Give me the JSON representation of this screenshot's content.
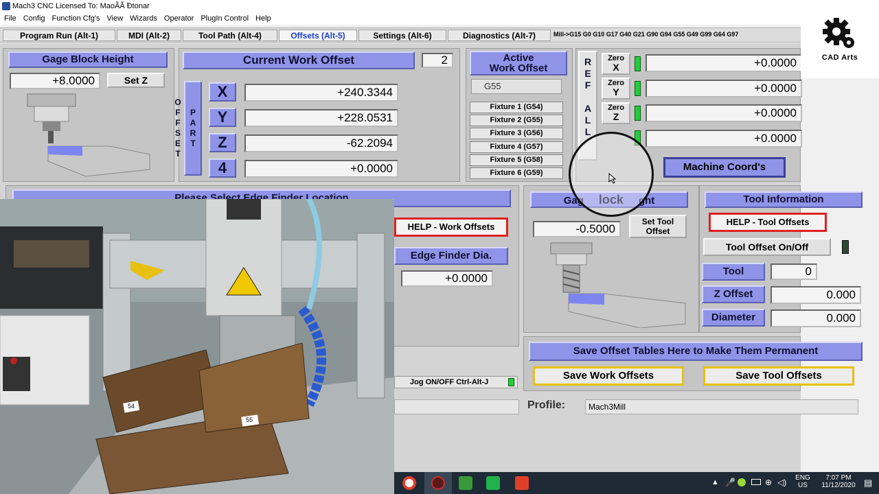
{
  "window": {
    "title": "Mach3 CNC  Licensed To: MaoÃÃ ̃Ðtonar"
  },
  "menu": [
    "File",
    "Config",
    "Function Cfg's",
    "View",
    "Wizards",
    "Operator",
    "PlugIn Control",
    "Help"
  ],
  "tabs": [
    {
      "label": "Program Run (Alt-1)"
    },
    {
      "label": "MDI (Alt-2)"
    },
    {
      "label": "Tool Path (Alt-4)"
    },
    {
      "label": "Offsets (Alt-5)"
    },
    {
      "label": "Settings (Alt-6)"
    },
    {
      "label": "Diagnostics (Alt-7)"
    }
  ],
  "gcodes": "Mill->G15  G0 G10 G17 G40 G21 G90 G94 G55 G49 G99 G64 G97",
  "gage_block_top": {
    "title": "Gage Block Height",
    "value": "+8.0000",
    "set_label": "Set Z"
  },
  "work_offset": {
    "title": "Current Work Offset",
    "index": "2",
    "side_label": "PART OFFSET",
    "axes": [
      {
        "axis": "X",
        "value": "+240.3344"
      },
      {
        "axis": "Y",
        "value": "+228.0531"
      },
      {
        "axis": "Z",
        "value": "-62.2094"
      },
      {
        "axis": "4",
        "value": "+0.0000"
      }
    ]
  },
  "active_offset": {
    "title_line1": "Active",
    "title_line2": "Work Offset",
    "value": "G55",
    "fixtures": [
      "Fixture 1 (G54)",
      "Fixture 2 (G55)",
      "Fixture 3 (G56)",
      "Fixture 4 (G57)",
      "Fixture 5 (G58)",
      "Fixture 6 (G59)"
    ]
  },
  "ref_all_home": "REF ALL HO",
  "zero_buttons": [
    {
      "label": "Zero",
      "axis": "X",
      "value": "+0.0000"
    },
    {
      "label": "Zero",
      "axis": "Y",
      "value": "+0.0000"
    },
    {
      "label": "Zero",
      "axis": "Z",
      "value": "+0.0000"
    },
    {
      "label": "",
      "axis": "",
      "value": "+0.0000"
    }
  ],
  "machine_coords_label": "Machine Coord's",
  "edge_finder": {
    "title": "Please Select Edge Finder Location",
    "help_label": "HELP - Work Offsets",
    "dia_label": "Edge Finder Dia.",
    "dia_value": "+0.0000",
    "jog_label": "Jog ON/OFF Ctrl-Alt-J"
  },
  "gage_block_tool": {
    "title_left": "Gag",
    "title_mid": "lock",
    "title_right": "ght",
    "value": "-0.5000",
    "set_label_1": "Set Tool",
    "set_label_2": "Offset"
  },
  "tool_info": {
    "title": "Tool Information",
    "help_label": "HELP - Tool Offsets",
    "toggle_label": "Tool Offset On/Off",
    "tool_label": "Tool",
    "tool_value": "0",
    "zoffset_label": "Z Offset",
    "zoffset_value": "0.000",
    "diameter_label": "Diameter",
    "diameter_value": "0.000"
  },
  "save": {
    "title": "Save Offset Tables Here to Make Them Permanent",
    "work_label": "Save Work Offsets",
    "tool_label": "Save Tool Offsets"
  },
  "profile": {
    "label": "Profile:",
    "value": "Mach3Mill"
  },
  "taskbar": {
    "lang1": "ENG",
    "lang2": "US",
    "time": "7:07 PM",
    "date": "11/12/2020"
  },
  "logo": {
    "text": "CAD Arts"
  },
  "video_labels": {
    "tag1": "54",
    "tag2": "55"
  },
  "colors": {
    "panel": "#c5c5c5",
    "label_blue": "#8f94e8",
    "led_green": "#1fcf3a",
    "help_red": "#e02020",
    "save_yellow": "#e8c010",
    "tab_active": "#1a3fd0"
  }
}
